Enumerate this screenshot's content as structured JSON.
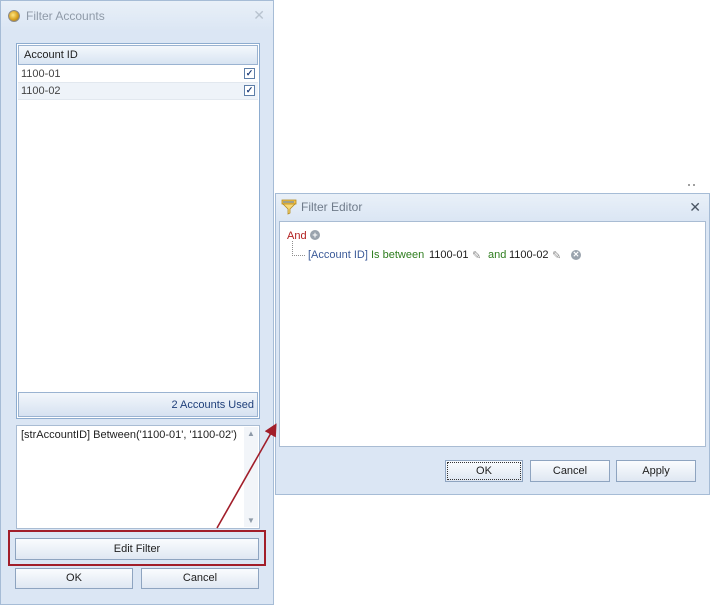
{
  "filter_accounts": {
    "title": "Filter Accounts",
    "close_icon": "close-icon",
    "grid": {
      "column_header": "Account ID",
      "rows": [
        {
          "account_id": "1100-01",
          "checked": true
        },
        {
          "account_id": "1100-02",
          "checked": true
        }
      ],
      "footer": "2 Accounts Used"
    },
    "expression": "[strAccountID] Between('1100-01', '1100-02')",
    "edit_filter_label": "Edit Filter",
    "ok_label": "OK",
    "cancel_label": "Cancel"
  },
  "filter_editor": {
    "title": "Filter Editor",
    "group_operator": "And",
    "condition": {
      "field": "[Account ID]",
      "operator": "Is between",
      "value1": "1100-01",
      "conjunction": "and",
      "value2": "1100-02"
    },
    "ok_label": "OK",
    "cancel_label": "Cancel",
    "apply_label": "Apply"
  },
  "annotation": {
    "highlight_color": "#a11e2a"
  }
}
